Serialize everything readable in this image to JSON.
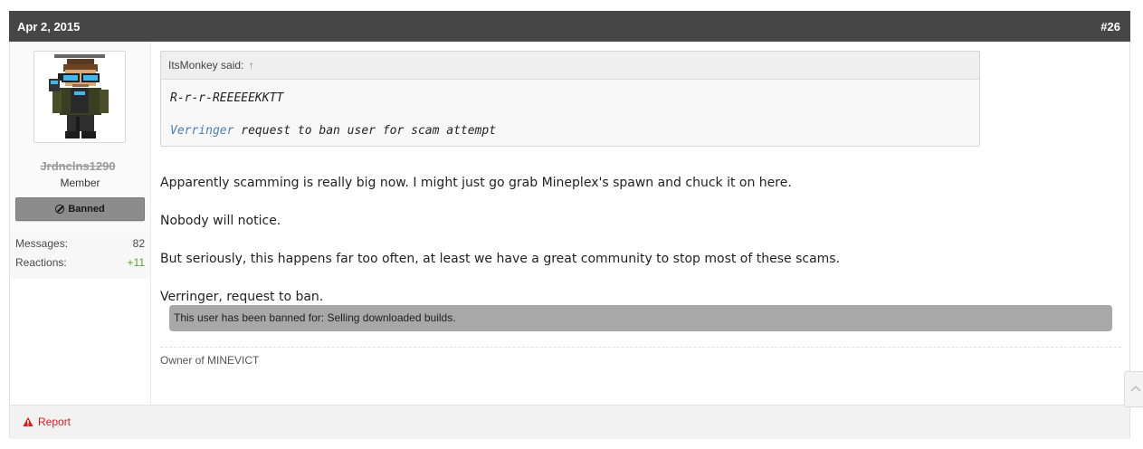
{
  "post": {
    "date": "Apr 2, 2015",
    "number": "#26"
  },
  "user": {
    "name": "Jrdnclns1290",
    "title": "Member",
    "banner": "Banned",
    "stats": [
      {
        "label": "Messages:",
        "value": "82"
      },
      {
        "label": "Reactions:",
        "value": "+11"
      }
    ]
  },
  "quote": {
    "author": "ItsMonkey said:",
    "arrow": "↑",
    "line1": "R-r-r-REEEEEKKTT",
    "link": "Verringer",
    "line2_rest": " request to ban user for scam attempt"
  },
  "message": {
    "paragraphs": [
      "Apparently scamming is really big now. I might just go grab Mineplex's spawn and chuck it on here.",
      "Nobody will notice.",
      "But seriously, this happens far too often, at least we have a great community to stop most of these scams.",
      "Verringer, request to ban."
    ]
  },
  "ban_notice": "This user has been banned for: Selling downloaded builds.",
  "signature": "Owner of MINEVICT",
  "footer": {
    "report_label": "Report"
  },
  "colors": {
    "header_bg": "#464646",
    "link": "#4a7fb5",
    "report": "#d42020",
    "positive": "#5aa02c"
  }
}
